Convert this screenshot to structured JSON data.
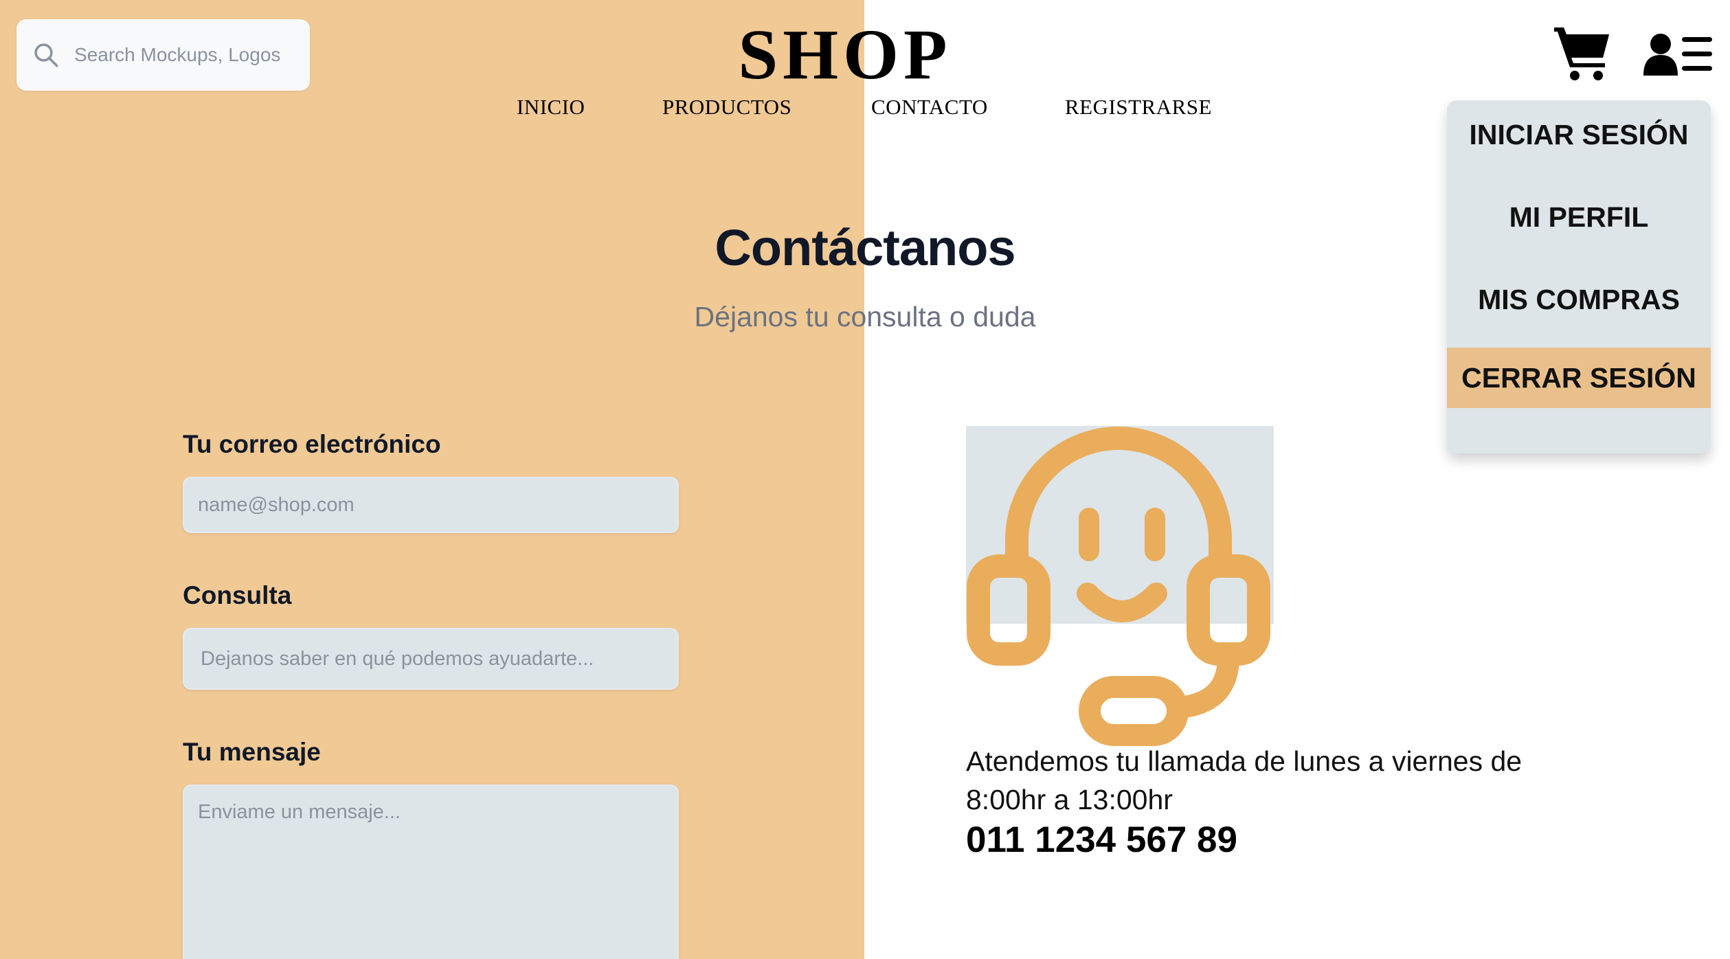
{
  "search": {
    "placeholder": "Search Mockups, Logos..."
  },
  "brand": {
    "title": "SHOP"
  },
  "nav": {
    "items": [
      "INICIO",
      "PRODUCTOS",
      "CONTACTO",
      "REGISTRARSE"
    ]
  },
  "user_menu": {
    "items": [
      "INICIAR SESIÓN",
      "MI PERFIL",
      "MIS COMPRAS",
      "CERRAR SESIÓN"
    ],
    "highlighted": "CERRAR SESIÓN"
  },
  "header": {
    "title": "Contáctanos",
    "subtitle": "Déjanos tu consulta o duda"
  },
  "form": {
    "email_label": "Tu correo electrónico",
    "email_placeholder": "name@shop.com",
    "subject_label": "Consulta",
    "subject_placeholder": "Dejanos saber en qué podemos ayuadarte...",
    "message_label": "Tu mensaje",
    "message_placeholder": "Enviame un mensaje..."
  },
  "support": {
    "hours": "Atendemos tu llamada de lunes a viernes de 8:00hr a 13:00hr",
    "phone": "011 1234 567 89"
  },
  "icons": {
    "search": "search-icon",
    "cart": "cart-icon",
    "user_menu": "user-menu-icon",
    "support": "headset-support-icon"
  },
  "colors": {
    "left_panel": "#f0c995",
    "accent": "#e9ad5c",
    "dropdown_bg": "#dde5e8",
    "dropdown_active": "#e9c08c",
    "field_bg": "#dde5e8"
  }
}
